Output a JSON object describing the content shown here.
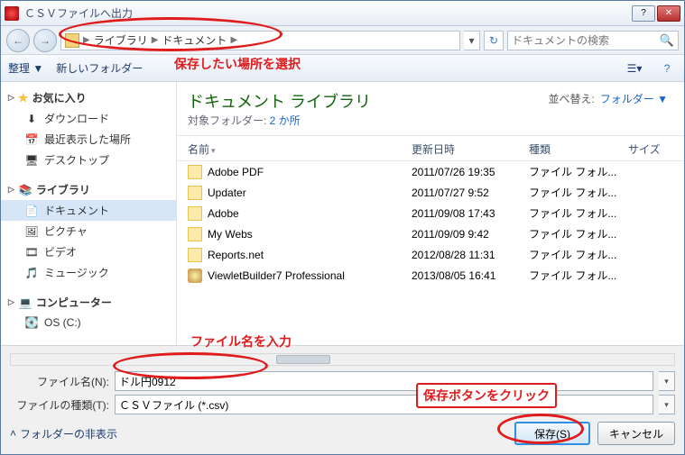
{
  "window": {
    "title": "ＣＳＶファイルへ出力"
  },
  "nav": {
    "breadcrumb_root": "ライブラリ",
    "breadcrumb_leaf": "ドキュメント",
    "search_placeholder": "ドキュメントの検索"
  },
  "toolbar": {
    "organize": "整理 ▼",
    "new_folder": "新しいフォルダー"
  },
  "sidebar": {
    "favorites": {
      "label": "お気に入り",
      "items": [
        "ダウンロード",
        "最近表示した場所",
        "デスクトップ"
      ]
    },
    "libraries": {
      "label": "ライブラリ",
      "items": [
        "ドキュメント",
        "ピクチャ",
        "ビデオ",
        "ミュージック"
      ]
    },
    "computer": {
      "label": "コンピューター",
      "items": [
        "OS (C:)"
      ]
    }
  },
  "content": {
    "library_title": "ドキュメント ライブラリ",
    "subfolder_label": "対象フォルダー: ",
    "subfolder_count": "2 か所",
    "sort_label": "並べ替え:",
    "sort_value": "フォルダー ▼",
    "columns": {
      "name": "名前",
      "date": "更新日時",
      "type": "種類",
      "size": "サイズ"
    },
    "files": [
      {
        "name": "Adobe PDF",
        "date": "2011/07/26 19:35",
        "type": "ファイル フォル...",
        "kind": "folder"
      },
      {
        "name": "Updater",
        "date": "2011/07/27 9:52",
        "type": "ファイル フォル...",
        "kind": "folder"
      },
      {
        "name": "Adobe",
        "date": "2011/09/08 17:43",
        "type": "ファイル フォル...",
        "kind": "folder"
      },
      {
        "name": "My Webs",
        "date": "2011/09/09 9:42",
        "type": "ファイル フォル...",
        "kind": "folder"
      },
      {
        "name": "Reports.net",
        "date": "2012/08/28 11:31",
        "type": "ファイル フォル...",
        "kind": "folder"
      },
      {
        "name": "ViewletBuilder7 Professional",
        "date": "2013/08/05 16:41",
        "type": "ファイル フォル...",
        "kind": "app"
      }
    ]
  },
  "form": {
    "filename_label": "ファイル名(N):",
    "filename_value": "ドル円0912",
    "filetype_label": "ファイルの種類(T):",
    "filetype_value": "ＣＳＶファイル (*.csv)",
    "hide_folders": "フォルダーの非表示",
    "save": "保存(S)",
    "cancel": "キャンセル"
  },
  "annotations": {
    "a1": "保存したい場所を選択",
    "a2": "ファイル名を入力",
    "a3": "保存ボタンをクリック"
  }
}
